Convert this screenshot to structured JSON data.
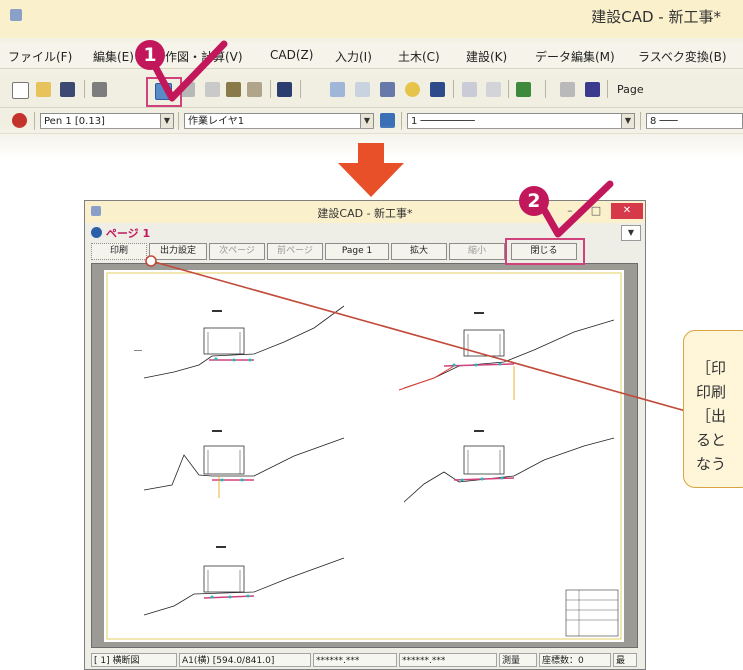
{
  "top_window": {
    "title": "建設CAD - 新工事*",
    "menus": [
      "ファイル(F)",
      "編集(E)",
      "作図・計算(V)",
      "CAD(Z)",
      "入力(I)",
      "土木(C)",
      "建設(K)",
      "データ編集(M)",
      "ラスベク変換(B)"
    ],
    "pen_combo": "Pen 1 [0.13]",
    "layer_combo": "作業レイヤ1",
    "line_combo": "1 ─────────",
    "size_combo": "8 ───",
    "page_label": "Page"
  },
  "steps": {
    "step1": "1",
    "step2": "2"
  },
  "preview_window": {
    "title": "建設CAD - 新工事*",
    "page_label": "ページ 1",
    "buttons": {
      "print": "印刷",
      "output_settings": "出力設定",
      "next_page": "次ページ",
      "prev_page": "前ページ",
      "page": "Page 1",
      "zoom_in": "拡大",
      "zoom_out": "縮小",
      "close": "閉じる"
    },
    "status": {
      "sheet": "[ 1] 横断図",
      "paper": "A1(横) [594.0/841.0]",
      "coord_x": "******.***",
      "coord_y": "******.***",
      "mode": "測量",
      "coord_count": "座標数：0",
      "last": "最"
    }
  },
  "callout": {
    "lines": [
      "［印",
      "印刷",
      "［出",
      "ると",
      "なう"
    ]
  },
  "colors": {
    "accent": "#c2185b",
    "arrow": "#e8502a",
    "highlight_box": "#d0427c",
    "callout_border": "#d9a441"
  }
}
